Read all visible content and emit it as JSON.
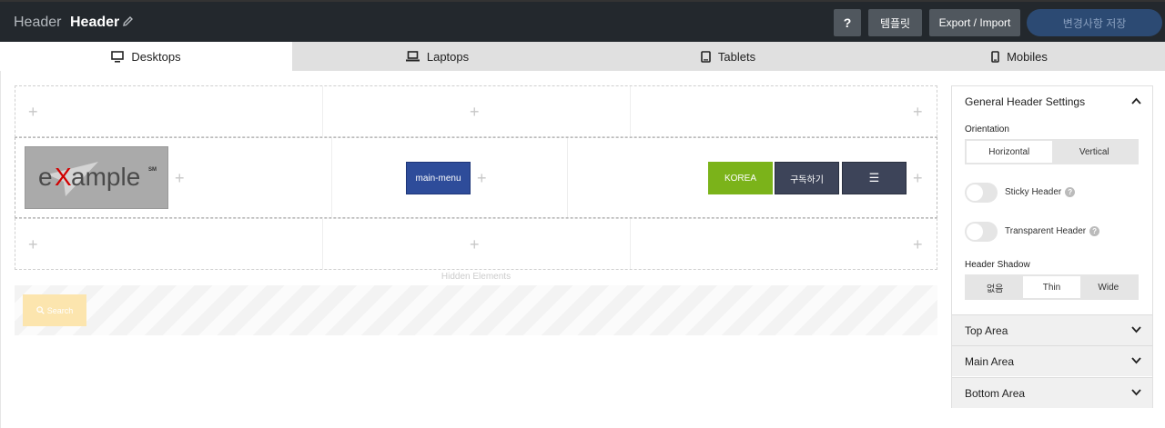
{
  "topbar": {
    "crumb": "Header",
    "title": "Header",
    "help_label": "?",
    "templates_label": "템플릿",
    "export_label": "Export / Import",
    "save_label": "변경사항 저장"
  },
  "tabs": [
    {
      "label": "Desktops",
      "icon": "monitor-icon",
      "active": true
    },
    {
      "label": "Laptops",
      "icon": "laptop-icon",
      "active": false
    },
    {
      "label": "Tablets",
      "icon": "tablet-icon",
      "active": false
    },
    {
      "label": "Mobiles",
      "icon": "mobile-icon",
      "active": false
    }
  ],
  "builder": {
    "plus": "+",
    "logo": {
      "letter_e": "e",
      "letter_x": "X",
      "rest": "ample",
      "mark": "SM"
    },
    "main_menu_label": "main-menu",
    "korea_label": "KOREA",
    "subscribe_label": "구독하기",
    "hamburger_label": "☰",
    "hidden_label": "Hidden Elements",
    "search_label": "Search"
  },
  "panel": {
    "title": "General Header Settings",
    "orientation_label": "Orientation",
    "orientation_options": [
      "Horizontal",
      "Vertical"
    ],
    "orientation_selected": "Horizontal",
    "sticky_label": "Sticky Header",
    "sticky_on": false,
    "transparent_label": "Transparent Header",
    "transparent_on": false,
    "shadow_label": "Header Shadow",
    "shadow_options": [
      "없음",
      "Thin",
      "Wide"
    ],
    "shadow_selected": "Thin",
    "sections": [
      "Top Area",
      "Main Area",
      "Bottom Area"
    ]
  },
  "colors": {
    "topbar": "#23282d",
    "main_menu": "#2e4c9a",
    "korea": "#7bb31a",
    "dark_button": "#3d4459",
    "search": "#fce5ae"
  }
}
